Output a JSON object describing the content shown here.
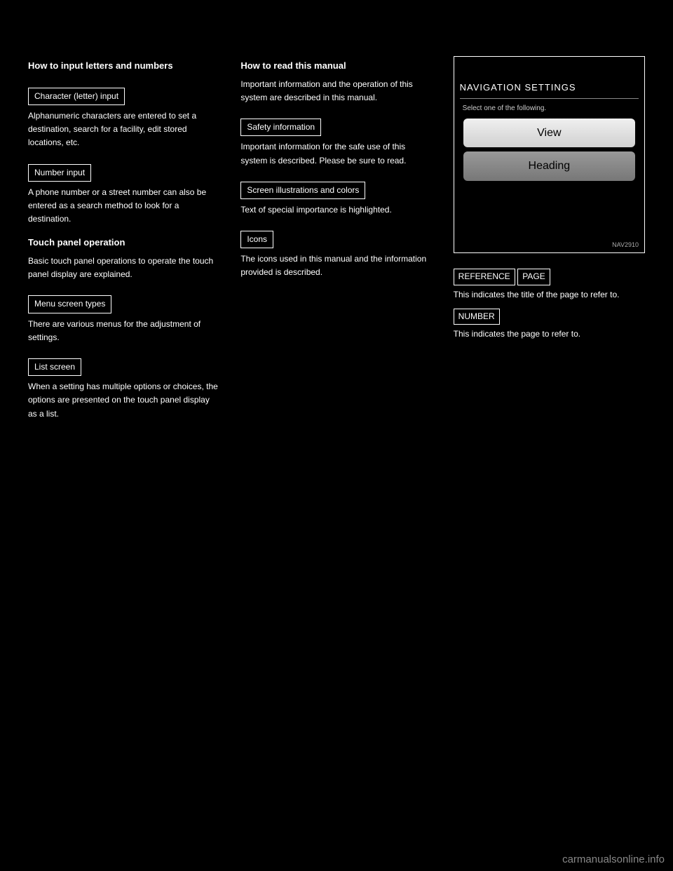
{
  "column1": {
    "topic1": "How to input letters and numbers",
    "block1_label": "Character (letter) input",
    "block1_text": "Alphanumeric characters are entered to set a destination, search for a facility, edit stored locations, etc.",
    "block2_label": "Number input",
    "block2_text": "A phone number or a street number can also be entered as a search method to look for a destination.",
    "topic2": "Touch panel operation",
    "touch_text": "Basic touch panel operations to operate the touch panel display are explained.",
    "block3_label": "Menu screen types",
    "block3_text": "There are various menus for the adjustment of settings.",
    "block4_label": "List screen",
    "block4_text": "When a setting has multiple options or choices, the options are presented on the touch panel display as a list."
  },
  "column2": {
    "topic": "How to read this manual",
    "intro": "Important information and the operation of this system are described in this manual.",
    "block1_label": "Safety information",
    "block1_text": "Important information for the safe use of this system is described. Please be sure to read.",
    "block2_label": "Screen illustrations and colors",
    "block2_text": "Text of special importance is highlighted.",
    "block3_label": "Icons",
    "block3_text": "The icons used in this manual and the information provided is described."
  },
  "column3": {
    "screen": {
      "title": "NAVIGATION SETTINGS",
      "prompt": "Select one of the following.",
      "btn1": "View",
      "btn2": "Heading",
      "manual_label": "NAV2910"
    },
    "ref_label": "REFERENCE",
    "ref_label2": "PAGE",
    "ref_text1": "This indicates the title of the page to refer to.",
    "ref_label3": "NUMBER",
    "ref_text2": "This indicates the page to refer to."
  },
  "watermark": "carmanualsonline.info"
}
